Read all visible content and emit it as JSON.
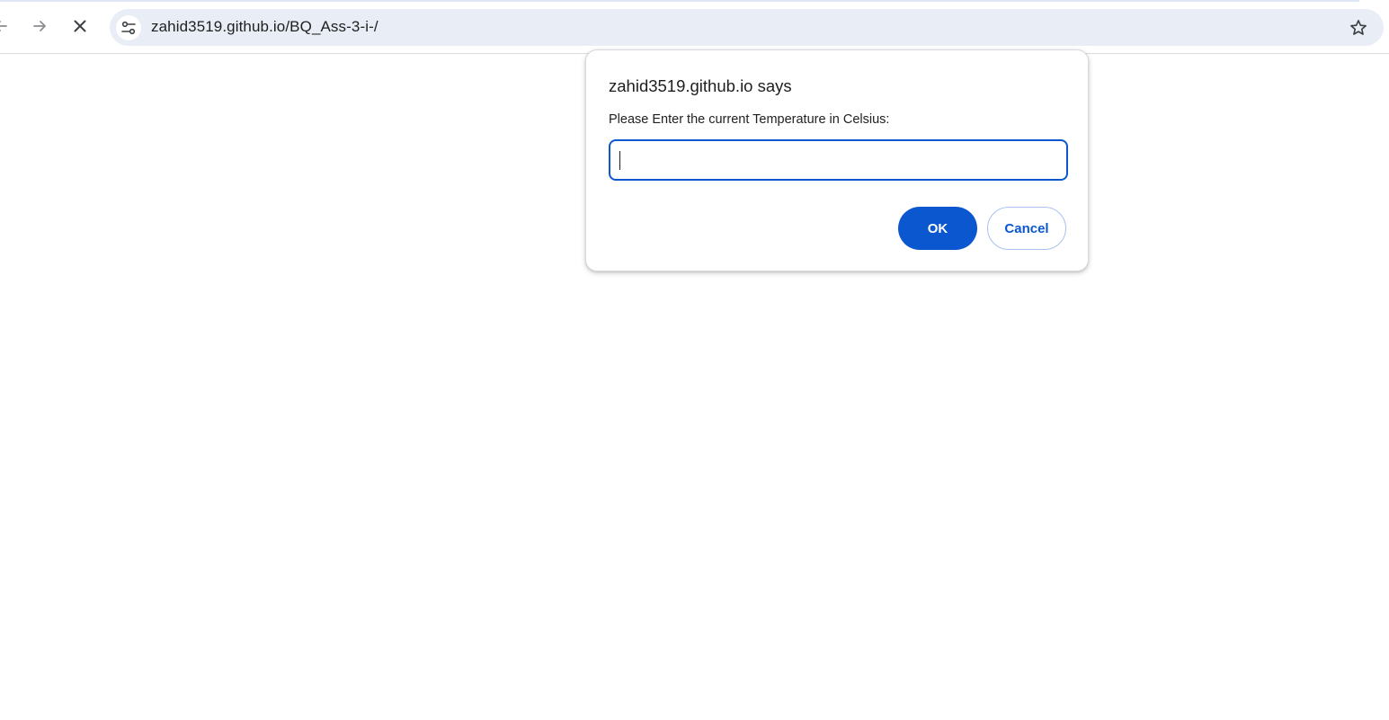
{
  "browser": {
    "url": "zahid3519.github.io/BQ_Ass-3-i-/",
    "icons": {
      "back": "arrow-left-icon",
      "forward": "arrow-right-icon",
      "stop": "close-icon",
      "site_info": "tune-icon",
      "bookmark": "star-outline-icon"
    }
  },
  "dialog": {
    "title": "zahid3519.github.io says",
    "message": "Please Enter the current Temperature in Celsius:",
    "input_value": "",
    "ok_label": "OK",
    "cancel_label": "Cancel"
  },
  "colors": {
    "accent": "#0b57d0",
    "omnibox_bg": "#e9edf6",
    "text": "#1f1f1f"
  }
}
